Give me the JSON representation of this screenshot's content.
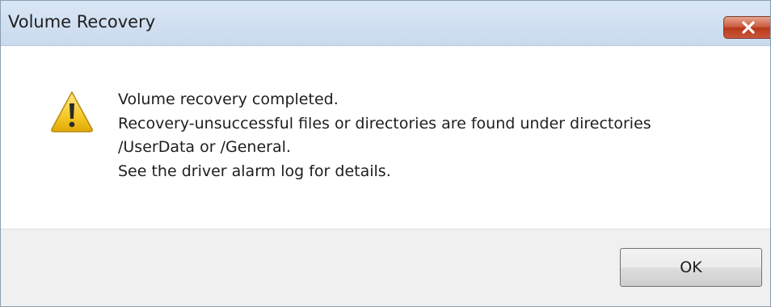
{
  "window": {
    "title": "Volume Recovery"
  },
  "dialog": {
    "icon": "warning-icon",
    "message_lines": [
      "Volume recovery completed.",
      "Recovery-unsuccessful files or directories are found under directories",
      "/UserData or /General.",
      "See the driver alarm log for details."
    ]
  },
  "buttons": {
    "ok_label": "OK"
  },
  "colors": {
    "titlebar": "#c9daee",
    "close_button": "#c9573a",
    "footer": "#f0f0f0"
  }
}
